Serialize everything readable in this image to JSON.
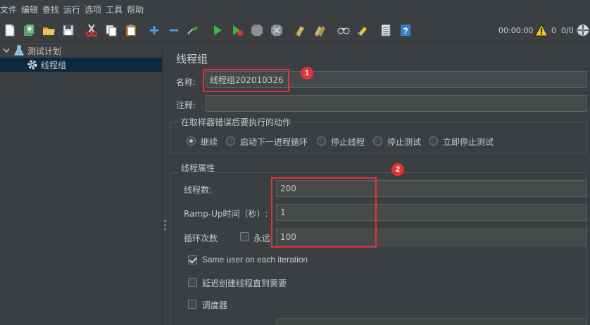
{
  "menu": {
    "items": [
      "文件",
      "编辑",
      "查找",
      "运行",
      "选项",
      "工具",
      "帮助"
    ]
  },
  "toolbar": {
    "icons": [
      "new-icon",
      "templates-icon",
      "open-icon",
      "save-icon",
      "cut-icon",
      "copy-icon",
      "paste-icon",
      "expand-icon",
      "collapse-icon",
      "toggle-icon",
      "start-icon",
      "start-no-pause-icon",
      "stop-icon",
      "shutdown-icon",
      "clear-icon",
      "clear-all-icon",
      "search-icon",
      "reset-search-icon",
      "function-helper-icon",
      "help-icon"
    ],
    "timer": "00:00:00",
    "warning_count": "0",
    "thread_count": "0/0"
  },
  "tree": {
    "items": [
      {
        "label": "测试计划",
        "icon": "flask-icon",
        "expanded": true
      },
      {
        "label": "线程组",
        "icon": "gear-icon",
        "selected": true
      }
    ]
  },
  "panel": {
    "title": "线程组",
    "name_label": "名称:",
    "name_value": "线程组202010326",
    "comment_label": "注释:",
    "comment_value": "",
    "error_group_title": "在取样器错误后要执行的动作",
    "error_actions": [
      {
        "label": "继续",
        "selected": true
      },
      {
        "label": "启动下一进程循环",
        "selected": false
      },
      {
        "label": "停止线程",
        "selected": false
      },
      {
        "label": "停止测试",
        "selected": false
      },
      {
        "label": "立即停止测试",
        "selected": false
      }
    ],
    "thread_props_title": "线程属性",
    "threads_label": "线程数:",
    "threads_value": "200",
    "rampup_label": "Ramp-Up时间（秒）:",
    "rampup_value": "1",
    "loop_label": "循环次数",
    "forever_label": "永远",
    "forever_checked": false,
    "loop_value": "100",
    "same_user_label": "Same user on each iteration",
    "same_user_checked": true,
    "delay_label": "延迟创建线程直到需要",
    "delay_checked": false,
    "scheduler_label": "调度器",
    "scheduler_checked": false
  },
  "annotations": {
    "badge1": "1",
    "badge2": "2",
    "color": "#e0333a"
  }
}
